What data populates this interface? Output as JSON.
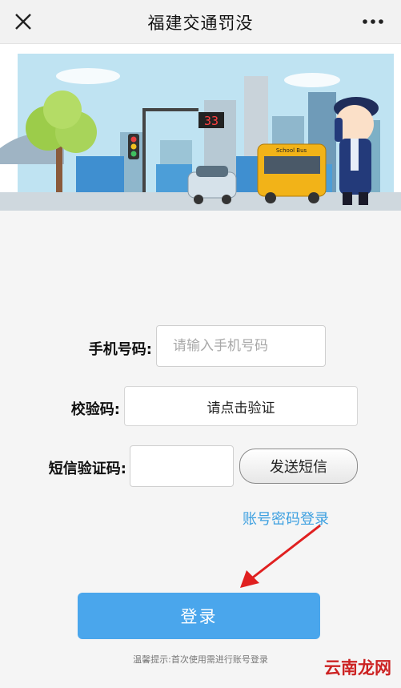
{
  "header": {
    "title": "福建交通罚没",
    "close_icon": "close-icon",
    "more_icon": "more-icon"
  },
  "banner": {
    "timer_value": "33",
    "bus_text": "School Bus"
  },
  "form": {
    "phone_label": "手机号码:",
    "phone_placeholder": "请输入手机号码",
    "captcha_label": "校验码:",
    "captcha_text": "请点击验证",
    "sms_label": "短信验证码:",
    "send_sms_label": "发送短信",
    "account_login_link": "账号密码登录",
    "login_label": "登录",
    "hint": "温馨提示:首次使用需进行账号登录"
  },
  "watermark": "云南龙网",
  "colors": {
    "accent": "#4aa6ec",
    "link": "#3da0e0",
    "annotation_arrow": "#e02020"
  }
}
